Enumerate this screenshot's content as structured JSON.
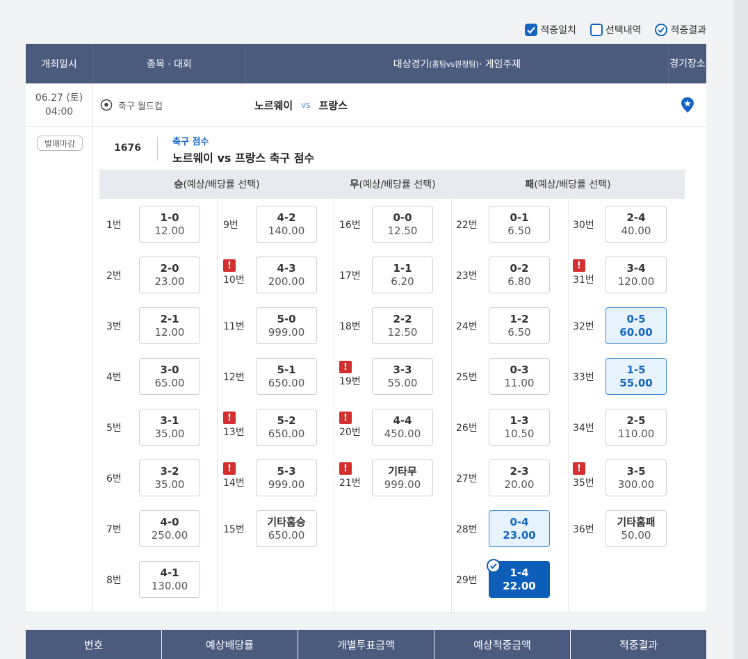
{
  "legend": {
    "match_label": "적중일치",
    "select_label": "선택내역",
    "result_label": "적중결과"
  },
  "table_header": {
    "date": "개최일시",
    "sport": "종목 · 대회",
    "match_main": "대상경기",
    "match_small": "(홈팀vs원정팀)",
    "match_tail": " · 게임주제",
    "venue_line1": "경기",
    "venue_line2": "장소"
  },
  "game": {
    "date": "06.27 (토)",
    "time": "04:00",
    "league": "축구 월드컵",
    "home": "노르웨이",
    "vs": "vs",
    "away": "프랑스"
  },
  "detail": {
    "status": "발매마감",
    "game_no": "1676",
    "category": "축구 점수",
    "title": "노르웨이 vs 프랑스 축구 점수"
  },
  "options_header": {
    "win_bold": "승",
    "win_rest": "(예상/배당률 선택)",
    "draw_bold": "무",
    "draw_rest": "(예상/배당률 선택)",
    "lose_bold": "패",
    "lose_rest": "(예상/배당률 선택)"
  },
  "options": [
    {
      "no": "1번",
      "score": "1-0",
      "odds": "12.00",
      "state": "normal",
      "warn": false
    },
    {
      "no": "2번",
      "score": "2-0",
      "odds": "23.00",
      "state": "normal",
      "warn": false
    },
    {
      "no": "3번",
      "score": "2-1",
      "odds": "12.00",
      "state": "normal",
      "warn": false
    },
    {
      "no": "4번",
      "score": "3-0",
      "odds": "65.00",
      "state": "normal",
      "warn": false
    },
    {
      "no": "5번",
      "score": "3-1",
      "odds": "35.00",
      "state": "normal",
      "warn": false
    },
    {
      "no": "6번",
      "score": "3-2",
      "odds": "35.00",
      "state": "normal",
      "warn": false
    },
    {
      "no": "7번",
      "score": "4-0",
      "odds": "250.00",
      "state": "normal",
      "warn": false
    },
    {
      "no": "8번",
      "score": "4-1",
      "odds": "130.00",
      "state": "normal",
      "warn": false
    },
    {
      "no": "9번",
      "score": "4-2",
      "odds": "140.00",
      "state": "normal",
      "warn": false
    },
    {
      "no": "10번",
      "score": "4-3",
      "odds": "200.00",
      "state": "normal",
      "warn": true
    },
    {
      "no": "11번",
      "score": "5-0",
      "odds": "999.00",
      "state": "normal",
      "warn": false
    },
    {
      "no": "12번",
      "score": "5-1",
      "odds": "650.00",
      "state": "normal",
      "warn": false
    },
    {
      "no": "13번",
      "score": "5-2",
      "odds": "650.00",
      "state": "normal",
      "warn": true
    },
    {
      "no": "14번",
      "score": "5-3",
      "odds": "999.00",
      "state": "normal",
      "warn": true
    },
    {
      "no": "15번",
      "score": "기타홈승",
      "odds": "650.00",
      "state": "normal",
      "warn": false
    },
    {
      "no": "16번",
      "score": "0-0",
      "odds": "12.50",
      "state": "normal",
      "warn": false
    },
    {
      "no": "17번",
      "score": "1-1",
      "odds": "6.20",
      "state": "normal",
      "warn": false
    },
    {
      "no": "18번",
      "score": "2-2",
      "odds": "12.50",
      "state": "normal",
      "warn": false
    },
    {
      "no": "19번",
      "score": "3-3",
      "odds": "55.00",
      "state": "normal",
      "warn": true
    },
    {
      "no": "20번",
      "score": "4-4",
      "odds": "450.00",
      "state": "normal",
      "warn": true
    },
    {
      "no": "21번",
      "score": "기타무",
      "odds": "999.00",
      "state": "normal",
      "warn": true
    },
    {
      "no": "22번",
      "score": "0-1",
      "odds": "6.50",
      "state": "normal",
      "warn": false
    },
    {
      "no": "23번",
      "score": "0-2",
      "odds": "6.80",
      "state": "normal",
      "warn": false
    },
    {
      "no": "24번",
      "score": "1-2",
      "odds": "6.50",
      "state": "normal",
      "warn": false
    },
    {
      "no": "25번",
      "score": "0-3",
      "odds": "11.00",
      "state": "normal",
      "warn": false
    },
    {
      "no": "26번",
      "score": "1-3",
      "odds": "10.50",
      "state": "normal",
      "warn": false
    },
    {
      "no": "27번",
      "score": "2-3",
      "odds": "20.00",
      "state": "normal",
      "warn": false
    },
    {
      "no": "28번",
      "score": "0-4",
      "odds": "23.00",
      "state": "predicted",
      "warn": false
    },
    {
      "no": "29번",
      "score": "1-4",
      "odds": "22.00",
      "state": "hit",
      "warn": false
    },
    {
      "no": "30번",
      "score": "2-4",
      "odds": "40.00",
      "state": "normal",
      "warn": false
    },
    {
      "no": "31번",
      "score": "3-4",
      "odds": "120.00",
      "state": "normal",
      "warn": true
    },
    {
      "no": "32번",
      "score": "0-5",
      "odds": "60.00",
      "state": "predicted",
      "warn": false
    },
    {
      "no": "33번",
      "score": "1-5",
      "odds": "55.00",
      "state": "predicted",
      "warn": false
    },
    {
      "no": "34번",
      "score": "2-5",
      "odds": "110.00",
      "state": "normal",
      "warn": false
    },
    {
      "no": "35번",
      "score": "3-5",
      "odds": "300.00",
      "state": "normal",
      "warn": true
    },
    {
      "no": "36번",
      "score": "기타홈패",
      "odds": "50.00",
      "state": "normal",
      "warn": false
    }
  ],
  "bottom_header": [
    "번호",
    "예상배당률",
    "개별투표금액",
    "예상적중금액",
    "적중결과"
  ],
  "icons": {
    "legend_check": "checkbox-checked-icon",
    "legend_select": "checkbox-empty-icon",
    "legend_result": "check-circle-icon",
    "league": "soccer-ball-icon",
    "venue": "location-pin-icon",
    "warning": "warning-icon",
    "hit": "check-circle-icon"
  },
  "colors": {
    "header_bg": "#4b5b7e",
    "accent": "#1565c0",
    "hit_bg": "#0d5eb8",
    "predicted_bg": "#e7f3fc",
    "warning": "#d32f2f"
  }
}
